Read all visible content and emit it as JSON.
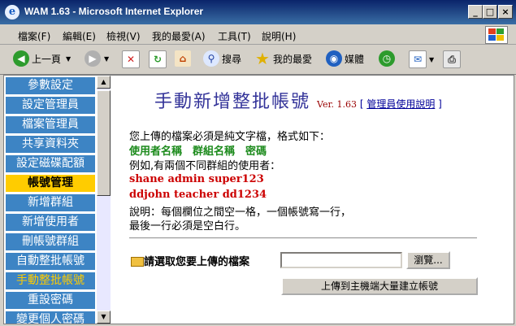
{
  "window": {
    "title": "WAM 1.63 - Microsoft Internet Explorer",
    "min": "_",
    "max": "□",
    "close": "×"
  },
  "menu": [
    "檔案(F)",
    "編輯(E)",
    "檢視(V)",
    "我的最愛(A)",
    "工具(T)",
    "說明(H)"
  ],
  "toolbar": {
    "back": "上一頁",
    "search": "搜尋",
    "favorites": "我的最愛",
    "media": "媒體"
  },
  "sidebar": {
    "items": [
      {
        "label": "參數設定"
      },
      {
        "label": "設定管理員"
      },
      {
        "label": "檔案管理員"
      },
      {
        "label": "共享資料夾"
      },
      {
        "label": "設定磁碟配額"
      },
      {
        "label": "帳號管理"
      },
      {
        "label": "新增群組"
      },
      {
        "label": "新增使用者"
      },
      {
        "label": "刪帳號群組"
      },
      {
        "label": "自動整批帳號"
      },
      {
        "label": "手動整批帳號"
      },
      {
        "label": "重設密碼"
      },
      {
        "label": "變更個人密碼"
      }
    ]
  },
  "main": {
    "title": "手動新增整批帳號",
    "version": "Ver. 1.63",
    "help_open": " [ ",
    "help_link": "管理員使用說明",
    "help_close": " ]",
    "intro": "您上傳的檔案必須是純文字檔，格式如下：",
    "format": "使用者名稱　群組名稱　密碼",
    "example_intro": "例如,有兩個不同群組的使用者：",
    "example1": "shane admin super123",
    "example2": "ddjohn teacher dd1234",
    "note1": "說明：每個欄位之間空一格，一個帳號寫一行，",
    "note2": "最後一行必須是空白行。",
    "upload_label": "請選取您要上傳的檔案",
    "file_value": "",
    "browse_button": "瀏覽...",
    "submit_button": "上傳到主機端大量建立帳號"
  }
}
